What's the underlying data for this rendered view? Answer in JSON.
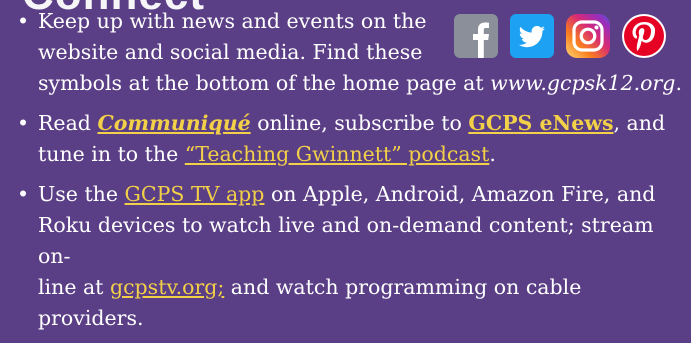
{
  "heading": "Connect",
  "colors": {
    "background": "#5b3f86",
    "text": "#ffffff",
    "link": "#f2d048",
    "facebook": "#8a8f99",
    "twitter": "#1da1f2",
    "instagram_gradient": [
      "#feda75",
      "#fa7e1e",
      "#d62976",
      "#962fbf",
      "#4f5bd5"
    ],
    "pinterest": "#e60023"
  },
  "icons": [
    "facebook-icon",
    "twitter-icon",
    "instagram-icon",
    "pinterest-icon"
  ],
  "items": [
    {
      "line1": "Keep up with news and events on the",
      "line2": "website and social media. Find these",
      "line3_prefix": "symbols at the bottom of the home page at ",
      "url": "www.gcpsk12.org",
      "line3_suffix": "."
    },
    {
      "p1": "Read ",
      "communique": "Communiqué",
      "p2": " online, subscribe to ",
      "enews": "GCPS eNews",
      "p3": ", and",
      "p4": "tune in to the ",
      "podcast": "“Teaching Gwinnett” podcast",
      "p5": "."
    },
    {
      "p1": "Use the ",
      "tvapp": "GCPS TV app",
      "p2": " on Apple, Android, Amazon Fire, and",
      "p3": "Roku devices to watch live and on-demand content; stream on-",
      "p4": "line at ",
      "site": "gcpstv.org;",
      "p5": " and watch programming on cable providers."
    }
  ]
}
